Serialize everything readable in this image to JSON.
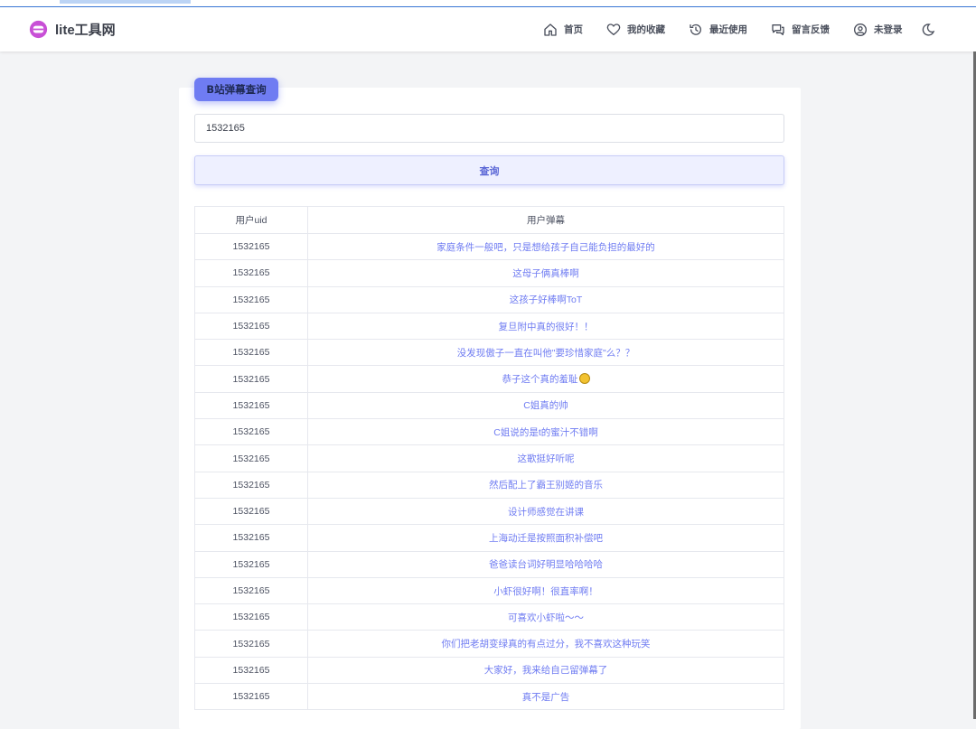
{
  "header": {
    "brand": "lite工具网",
    "nav": [
      {
        "label": "首页",
        "icon": "home-icon"
      },
      {
        "label": "我的收藏",
        "icon": "heart-icon"
      },
      {
        "label": "最近使用",
        "icon": "history-icon"
      },
      {
        "label": "留言反馈",
        "icon": "message-icon"
      },
      {
        "label": "未登录",
        "icon": "user-icon"
      }
    ]
  },
  "tool": {
    "title": "B站弹幕查询",
    "input_value": "1532165",
    "button_label": "查询"
  },
  "table": {
    "columns": [
      "用户uid",
      "用户弹幕"
    ],
    "rows": [
      {
        "uid": "1532165",
        "msg": "家庭条件一般吧，只是想给孩子自己能负担的最好的"
      },
      {
        "uid": "1532165",
        "msg": "这母子俩真棒啊"
      },
      {
        "uid": "1532165",
        "msg": "这孩子好棒啊ToT"
      },
      {
        "uid": "1532165",
        "msg": "复旦附中真的很好！！"
      },
      {
        "uid": "1532165",
        "msg": "没发现傲子一直在叫他\"要珍惜家庭\"么？？"
      },
      {
        "uid": "1532165",
        "msg": "恭子这个真的羞耻",
        "emoji": true
      },
      {
        "uid": "1532165",
        "msg": "C姐真的帅"
      },
      {
        "uid": "1532165",
        "msg": "C姐说的是t的蜜汁不错啊"
      },
      {
        "uid": "1532165",
        "msg": "这歌挺好听呢"
      },
      {
        "uid": "1532165",
        "msg": "然后配上了霸王别姬的音乐"
      },
      {
        "uid": "1532165",
        "msg": "设计师感觉在讲课"
      },
      {
        "uid": "1532165",
        "msg": "上海动迁是按照面积补偿吧"
      },
      {
        "uid": "1532165",
        "msg": "爸爸读台词好明显哈哈哈哈"
      },
      {
        "uid": "1532165",
        "msg": "小虾很好啊！很直率啊！"
      },
      {
        "uid": "1532165",
        "msg": "可喜欢小虾啦～～"
      },
      {
        "uid": "1532165",
        "msg": "你们把老胡变绿真的有点过分，我不喜欢这种玩笑"
      },
      {
        "uid": "1532165",
        "msg": "大家好，我来给自己留弹幕了"
      },
      {
        "uid": "1532165",
        "msg": "真不是广告"
      }
    ]
  },
  "colors": {
    "accent": "#6f7cf2",
    "brand_logo": "#c84fd6"
  }
}
